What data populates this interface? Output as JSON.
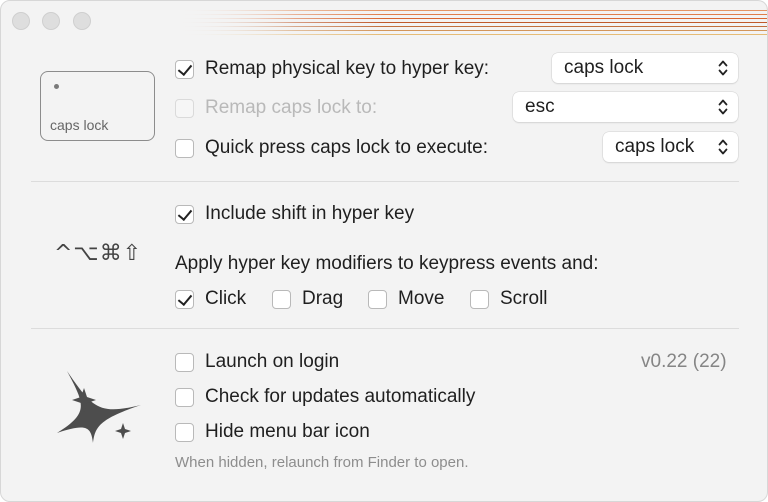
{
  "window": {
    "traffic_lights": [
      "close",
      "minimize",
      "zoom"
    ]
  },
  "key_preview": {
    "label": "caps lock"
  },
  "remap_physical": {
    "label": "Remap physical key to hyper key:",
    "checked": true,
    "selected": "caps lock"
  },
  "remap_caps": {
    "label": "Remap caps lock to:",
    "checked": false,
    "disabled": true,
    "selected": "esc"
  },
  "quick_press": {
    "label": "Quick press caps lock to execute:",
    "checked": false,
    "selected": "caps lock"
  },
  "include_shift": {
    "label": "Include shift in hyper key",
    "checked": true
  },
  "modifiers_symbols": "^⌥⌘⇧",
  "apply_label": "Apply hyper key modifiers to keypress events and:",
  "events": [
    {
      "label": "Click",
      "checked": true
    },
    {
      "label": "Drag",
      "checked": false
    },
    {
      "label": "Move",
      "checked": false
    },
    {
      "label": "Scroll",
      "checked": false
    }
  ],
  "launch_login": {
    "label": "Launch on login",
    "checked": false
  },
  "version": "v0.22 (22)",
  "check_updates": {
    "label": "Check for updates automatically",
    "checked": false
  },
  "hide_menu_icon": {
    "label": "Hide menu bar icon",
    "checked": false
  },
  "hide_hint": "When hidden, relaunch from Finder to open.",
  "colors": {
    "stripe_orange": "#d9612b",
    "text": "#1f1f1f",
    "disabled": "#b9b9b9"
  },
  "icons": [
    "sparkles-icon",
    "chevrons-updown-icon",
    "checkmark-icon"
  ]
}
